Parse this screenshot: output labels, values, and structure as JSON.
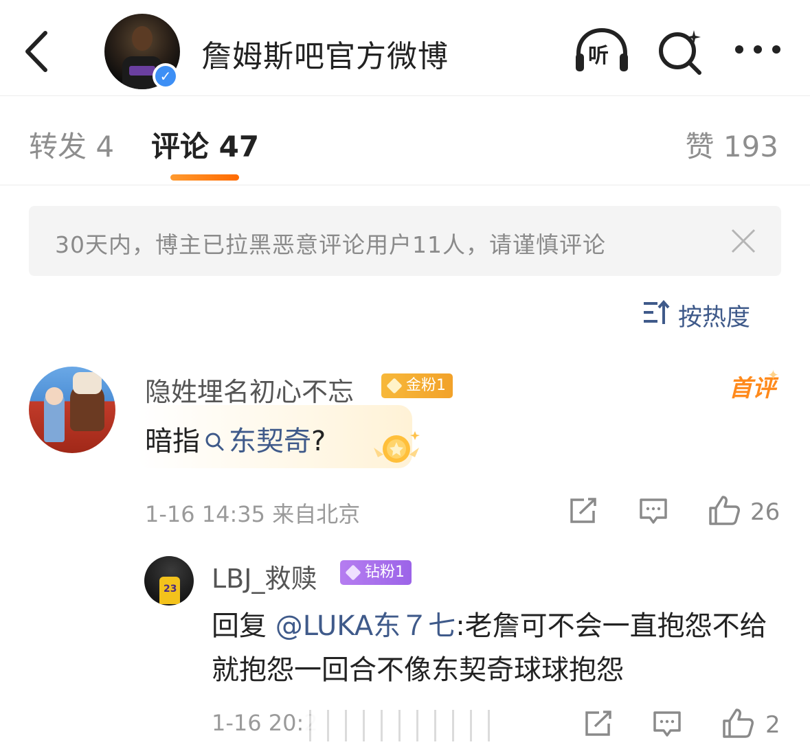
{
  "header": {
    "title": "詹姆斯吧官方微博",
    "listen_label": "听",
    "verified": true
  },
  "tabs": {
    "repost": "转发 4",
    "comment": "评论 47",
    "like": "赞 193",
    "active": "comment"
  },
  "notice": {
    "text": "30天内，博主已拉黑恶意评论用户11人，请谨慎评论"
  },
  "sort": {
    "label": "按热度"
  },
  "comments": [
    {
      "user": "隐姓埋名初心不忘",
      "badge": "金粉1",
      "tag": "首评",
      "text_prefix": "暗指",
      "topic_link": "东契奇",
      "text_suffix": "?",
      "meta": "1-16 14:35 来自北京",
      "likes": "26",
      "replies": [
        {
          "user": "LBJ_救赎",
          "badge": "钻粉1",
          "prefix": "回复 ",
          "mention": "@LUKA东７七",
          "text": ":老詹可不会一直抱怨不给就抱怨一回合不像东契奇球球抱怨",
          "meta": "1-16 20:2",
          "likes": "2"
        }
      ]
    }
  ],
  "colors": {
    "accent_orange": "#ff8a1c",
    "link_blue": "#3f5a8a",
    "gold_badge": "#f2a22a",
    "purple_badge": "#9c64e8",
    "verify_blue": "#3d8ff5"
  }
}
